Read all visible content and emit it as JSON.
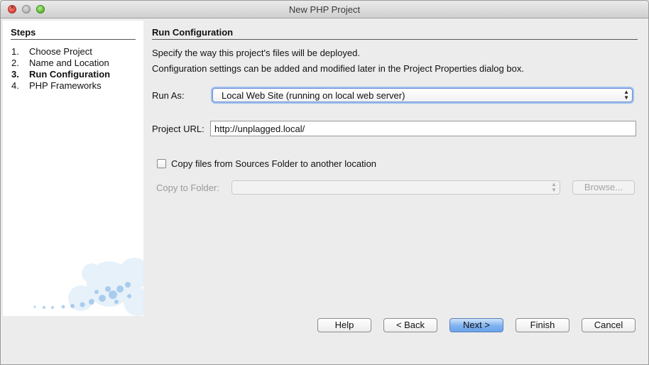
{
  "window": {
    "title": "New PHP Project"
  },
  "steps": {
    "heading": "Steps",
    "items": [
      {
        "num": "1.",
        "label": "Choose Project"
      },
      {
        "num": "2.",
        "label": "Name and Location"
      },
      {
        "num": "3.",
        "label": "Run Configuration"
      },
      {
        "num": "4.",
        "label": "PHP Frameworks"
      }
    ]
  },
  "main": {
    "heading": "Run Configuration",
    "desc1": "Specify the way this project's files will be deployed.",
    "desc2": "Configuration settings can be added and modified later in the Project Properties dialog box.",
    "run_as_label": "Run As:",
    "run_as_value": "Local Web Site (running on local web server)",
    "project_url_label": "Project URL:",
    "project_url_value": "http://unplagged.local/",
    "copy_checkbox_label": "Copy files from Sources Folder to another location",
    "copy_to_folder_label": "Copy to Folder:",
    "browse_label": "Browse..."
  },
  "buttons": {
    "help": "Help",
    "back": "< Back",
    "next": "Next >",
    "finish": "Finish",
    "cancel": "Cancel"
  }
}
